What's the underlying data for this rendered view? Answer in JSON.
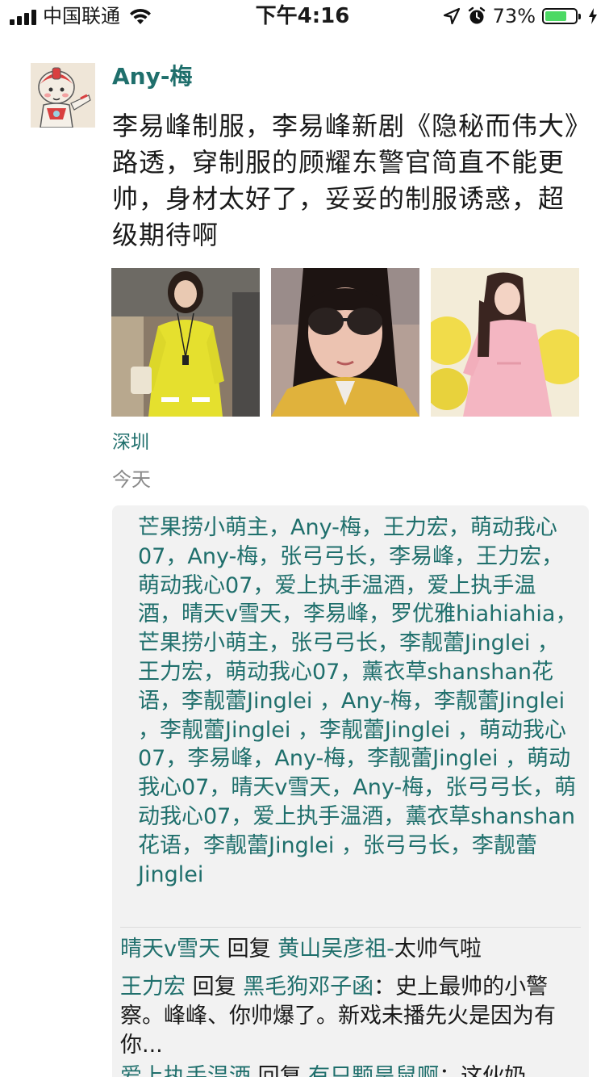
{
  "status_bar": {
    "carrier": "中国联通",
    "time": "下午4:16",
    "battery_percent": "73%",
    "battery_level": 0.73,
    "icons": [
      "signal-icon",
      "wifi-icon",
      "location-arrow-icon",
      "alarm-icon",
      "battery-icon",
      "charging-icon"
    ]
  },
  "post": {
    "username": "Any-梅",
    "text": "李易峰制服，李易峰新剧《隐秘而伟大》路透，穿制服的顾耀东警官简直不能更帅，身材太好了，妥妥的制服诱惑，超级期待啊",
    "location": "深圳",
    "time": "今天"
  },
  "likes_text": "芒果捞小萌主，Any-梅，王力宏，萌动我心07，Any-梅，张弓弓长，李易峰，王力宏，萌动我心07，爱上执手温酒，爱上执手温酒，晴天v雪天，李易峰，罗优雅hiahiahia，芒果捞小萌主，张弓弓长，李靓蕾Jinglei ，王力宏，萌动我心07，薰衣草shanshan花语，李靓蕾Jinglei ，Any-梅，李靓蕾Jinglei ，李靓蕾Jinglei ，李靓蕾Jinglei ，萌动我心07，李易峰，Any-梅，李靓蕾Jinglei ，萌动我心07，晴天v雪天，Any-梅，张弓弓长，萌动我心07，爱上执手温酒，薰衣草shanshan花语，李靓蕾Jinglei ，张弓弓长，李靓蕾Jinglei",
  "comments": [
    {
      "from": "晴天v雪天",
      "reply_word": " 回复 ",
      "to": "黄山吴彦祖-",
      "text": "太帅气啦"
    },
    {
      "from": "王力宏",
      "reply_word": " 回复 ",
      "to": "黑毛狗邓子函",
      "text": "：史上最帅的小警察。峰峰、你帅爆了。新戏未播先火是因为有你..."
    },
    {
      "from": "爱上执手温酒",
      "reply_word": " 回复 ",
      "to": "有只颗旱鼠啊",
      "text": "：这伙奶"
    }
  ],
  "colors": {
    "link": "#1f6f6c",
    "panel": "#f2f2f2",
    "battery": "#4cd964"
  }
}
